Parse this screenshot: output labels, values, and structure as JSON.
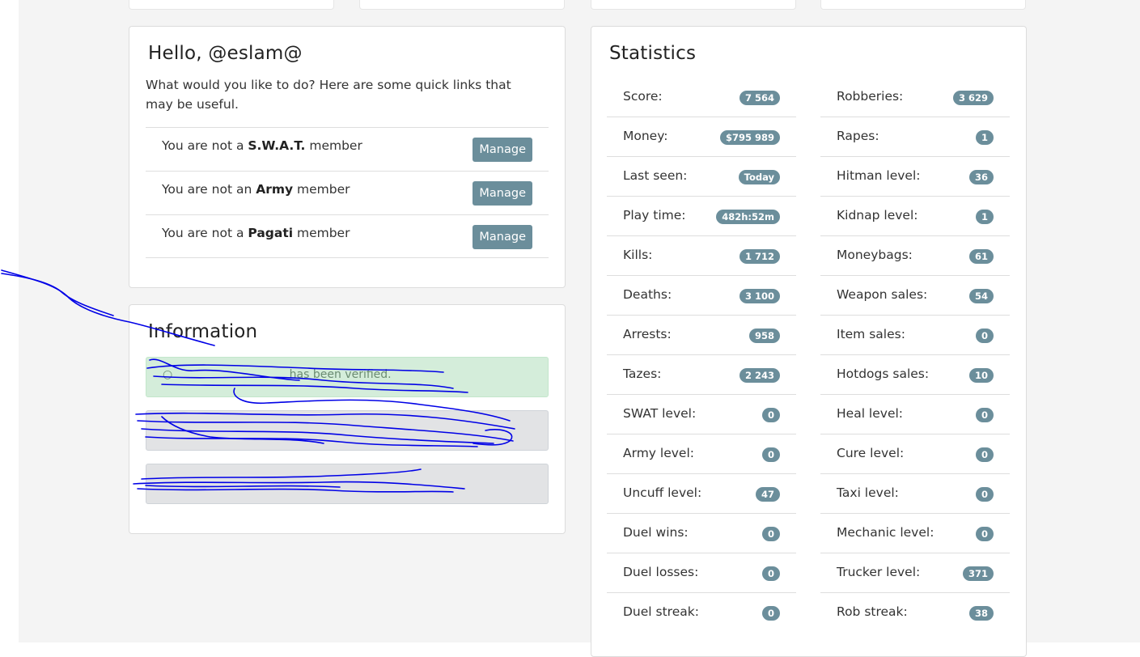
{
  "greeting": {
    "title": "Hello, @eslam@",
    "intro": "What would you like to do? Here are some quick links that may be useful."
  },
  "groups": [
    {
      "prefix": "You are not a ",
      "name": "S.W.A.T.",
      "suffix": " member",
      "button": "Manage"
    },
    {
      "prefix": "You are not an ",
      "name": "Army",
      "suffix": " member",
      "button": "Manage"
    },
    {
      "prefix": "You are not a ",
      "name": "Pagati",
      "suffix": " member",
      "button": "Manage"
    }
  ],
  "information": {
    "title": "Information",
    "alerts": [
      {
        "type": "success",
        "text": "has been verified."
      },
      {
        "type": "secondary",
        "text": ""
      },
      {
        "type": "secondary",
        "text": ""
      }
    ]
  },
  "statistics": {
    "title": "Statistics",
    "left": [
      {
        "label": "Score:",
        "value": "7 564"
      },
      {
        "label": "Money:",
        "value": "$795 989"
      },
      {
        "label": "Last seen:",
        "value": "Today"
      },
      {
        "label": "Play time:",
        "value": "482h:52m"
      },
      {
        "label": "Kills:",
        "value": "1 712"
      },
      {
        "label": "Deaths:",
        "value": "3 100"
      },
      {
        "label": "Arrests:",
        "value": "958"
      },
      {
        "label": "Tazes:",
        "value": "2 243"
      },
      {
        "label": "SWAT level:",
        "value": "0"
      },
      {
        "label": "Army level:",
        "value": "0"
      },
      {
        "label": "Uncuff level:",
        "value": "47"
      },
      {
        "label": "Duel wins:",
        "value": "0"
      },
      {
        "label": "Duel losses:",
        "value": "0"
      },
      {
        "label": "Duel streak:",
        "value": "0"
      }
    ],
    "right": [
      {
        "label": "Robberies:",
        "value": "3 629"
      },
      {
        "label": "Rapes:",
        "value": "1"
      },
      {
        "label": "Hitman level:",
        "value": "36"
      },
      {
        "label": "Kidnap level:",
        "value": "1"
      },
      {
        "label": "Moneybags:",
        "value": "61"
      },
      {
        "label": "Weapon sales:",
        "value": "54"
      },
      {
        "label": "Item sales:",
        "value": "0"
      },
      {
        "label": "Hotdogs sales:",
        "value": "10"
      },
      {
        "label": "Heal level:",
        "value": "0"
      },
      {
        "label": "Cure level:",
        "value": "0"
      },
      {
        "label": "Taxi level:",
        "value": "0"
      },
      {
        "label": "Mechanic level:",
        "value": "0"
      },
      {
        "label": "Trucker level:",
        "value": "371"
      },
      {
        "label": "Rob streak:",
        "value": "38"
      }
    ]
  },
  "colors": {
    "badge": "#6b8e9b",
    "button": "#6b8e9b",
    "success_bg": "#d4edda",
    "secondary_bg": "#e2e3e5",
    "scribble": "#0000e6"
  }
}
